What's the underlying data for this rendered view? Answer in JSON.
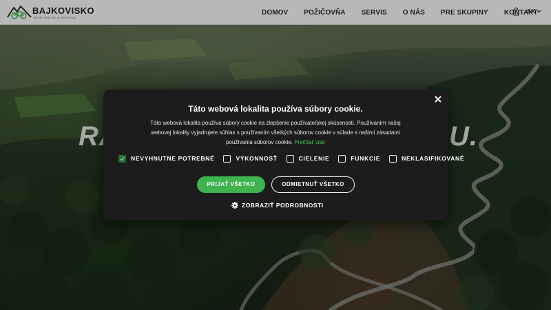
{
  "header": {
    "logo_name": "BAJKOVISKO",
    "logo_tagline": "BIKE RENTAL & SERVICE",
    "nav": [
      "DOMOV",
      "POŽIČOVŇA",
      "SERVIS",
      "O NÁS",
      "PRE SKUPINY",
      "KONTAKT"
    ],
    "cart_icon": "shopping-bag-icon",
    "language": "SK"
  },
  "hero": {
    "headline_left": "RA",
    "headline_right": "U."
  },
  "cookie_dialog": {
    "title": "Táto webová lokalita používa súbory cookie.",
    "body": "Táto webová lokalita používa súbory cookie na zlepšenie používateľskej skúsenosti. Používaním našej webovej lokality vyjadrujete súhlas s používaním všetkých súborov cookie v súlade s našimi zásadami používania súborov cookie.",
    "read_more": "Prečítať viac",
    "checkboxes": [
      {
        "label": "NEVYHNUTNE POTREBNÉ",
        "checked": true
      },
      {
        "label": "VÝKONNOSŤ",
        "checked": false
      },
      {
        "label": "CIELENIE",
        "checked": false
      },
      {
        "label": "FUNKCIE",
        "checked": false
      },
      {
        "label": "NEKLASIFIKOVANÉ",
        "checked": false
      }
    ],
    "accept_label": "PRIJAŤ VŠETKO",
    "reject_label": "ODMIETNUŤ VŠETKO",
    "details_label": "ZOBRAZIŤ PODROBNOSTI",
    "close_icon": "close-icon",
    "details_icon": "gear-icon"
  },
  "colors": {
    "accent_green": "#3eb34f",
    "dialog_bg": "#1c1c1c",
    "link_green": "#41c65a"
  }
}
